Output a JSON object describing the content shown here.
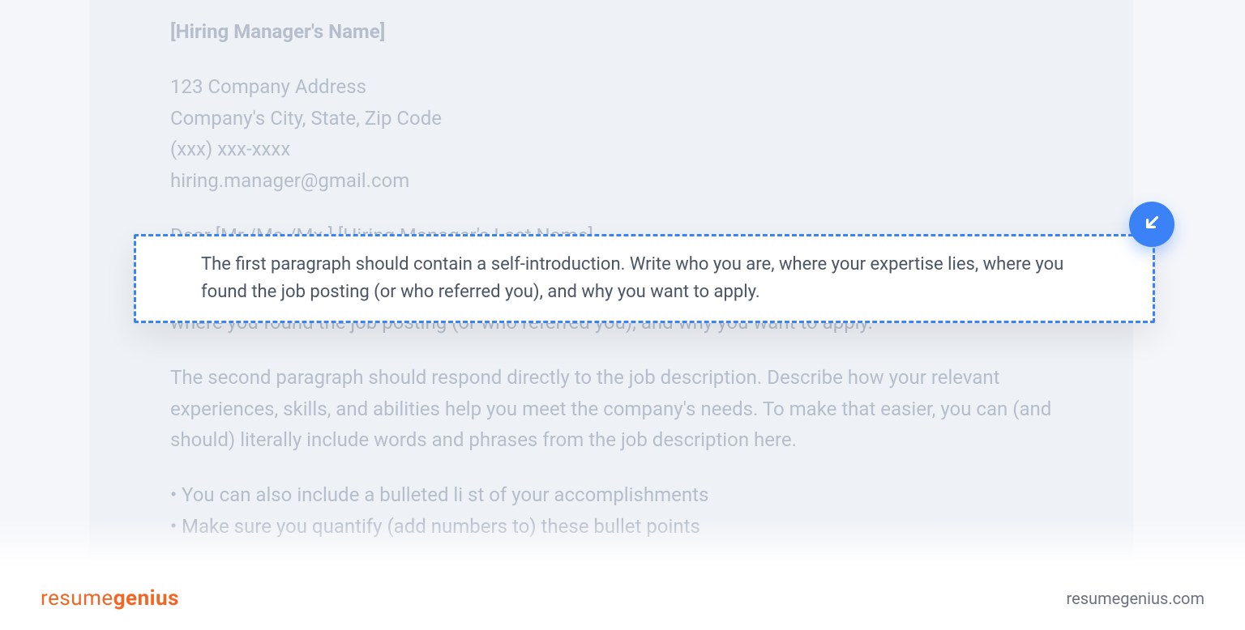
{
  "doc": {
    "heading": "[Hiring Manager's Name]",
    "address_lines": [
      "123 Company Address",
      "Company's City, State, Zip Code",
      "(xxx) xxx-xxxx",
      "hiring.manager@gmail.com"
    ],
    "salutation": "Dear [Mr./Ms./Mx.] [Hiring Manager's Last Name],",
    "para1": "The first paragraph should contain a self-introduction. Write who you are, where your expertise lies, where you found the job posting (or who referred you), and why you want to apply.",
    "para2": "The second paragraph should respond directly to the job description. Describe how your relevant experiences, skills, and abilities help you meet the company's needs. To make that easier, you can (and should) literally include words and phrases from the job description here.",
    "bullets": [
      "• You can also include a bulleted li st of your accomplishments",
      "• Make sure you quantify (add numbers to) these bullet points"
    ]
  },
  "callout": {
    "text": "The first paragraph should contain a self-introduction. Write who you are, where your expertise lies, where you found the job posting (or who referred you), and why you want to apply."
  },
  "footer": {
    "logo_part1": "resume",
    "logo_part2": "genius",
    "site": "resumegenius.com"
  }
}
